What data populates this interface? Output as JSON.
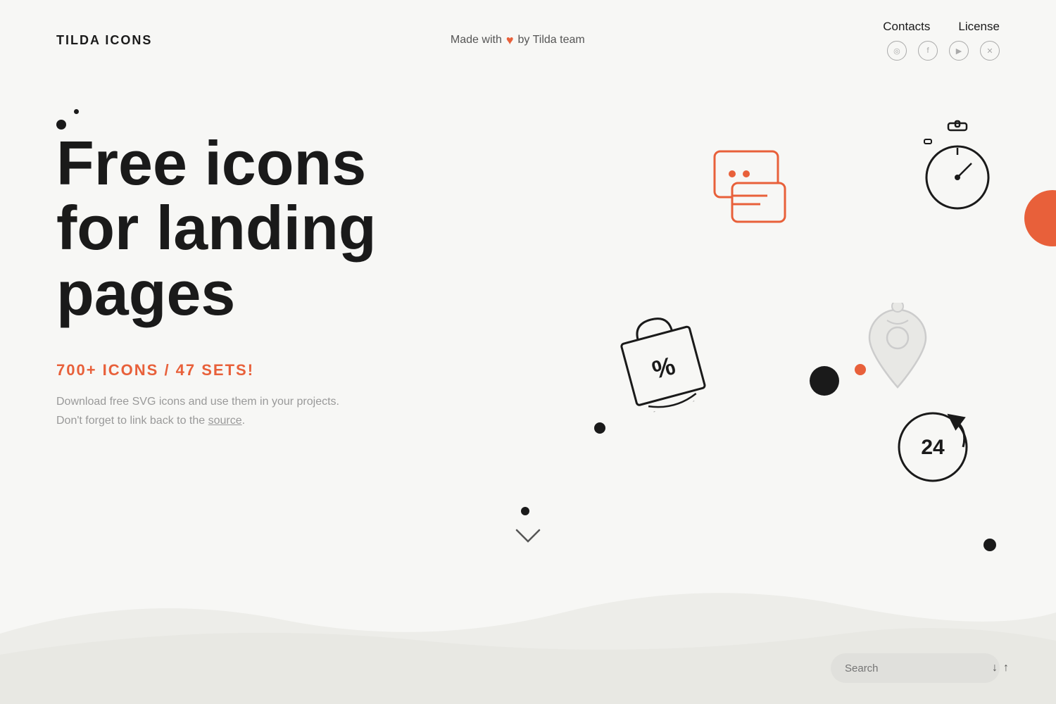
{
  "header": {
    "logo": "TILDA ICONS",
    "tagline_prefix": "Made with",
    "tagline_suffix": "by Tilda team",
    "nav": {
      "contacts": "Contacts",
      "license": "License"
    },
    "social": [
      {
        "name": "instagram",
        "symbol": "◎"
      },
      {
        "name": "facebook",
        "symbol": "f"
      },
      {
        "name": "youtube",
        "symbol": "▶"
      },
      {
        "name": "twitter",
        "symbol": "𝕏"
      }
    ]
  },
  "hero": {
    "title_line1": "Free icons",
    "title_line2": "for landing pages",
    "icons_count": "700+ ICONS / 47 SETS!",
    "description_line1": "Download free SVG icons and use them in your projects.",
    "description_line2": "Don't forget to link back to the",
    "source_link": "source",
    "description_end": "."
  },
  "search": {
    "placeholder": "Search"
  },
  "colors": {
    "accent": "#e8603a",
    "dark": "#1a1a1a",
    "light_bg": "#f7f7f5"
  }
}
